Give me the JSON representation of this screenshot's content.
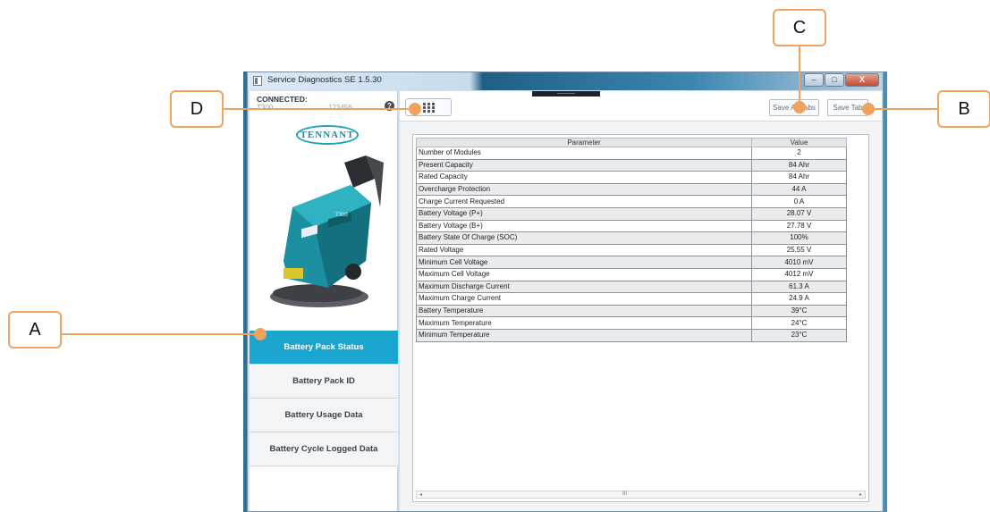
{
  "window": {
    "title": "Service Diagnostics SE 1.5.30",
    "minimize": "–",
    "maximize": "□",
    "close": "X"
  },
  "connection": {
    "status_label": "CONNECTED:",
    "model": "T300",
    "serial": "123456",
    "help": "?"
  },
  "brand": {
    "logo_text": "TENNANT",
    "accent_color": "#1aa6cf"
  },
  "sidebar": {
    "items": [
      {
        "label": "Battery Pack Status",
        "active": true
      },
      {
        "label": "Battery Pack ID",
        "active": false
      },
      {
        "label": "Battery Usage Data",
        "active": false
      },
      {
        "label": "Battery Cycle Logged Data",
        "active": false
      }
    ]
  },
  "toolbar": {
    "grid_icon": "grid-icon",
    "save_all_tabs": "Save All Tabs",
    "save_tab": "Save Tab"
  },
  "table": {
    "headers": [
      "Parameter",
      "Value"
    ],
    "rows": [
      [
        "Number of Modules",
        "2"
      ],
      [
        "Present Capacity",
        "84 Ahr"
      ],
      [
        "Rated Capacity",
        "84 Ahr"
      ],
      [
        "Overcharge Protection",
        "44 A"
      ],
      [
        "Charge Current Requested",
        "0 A"
      ],
      [
        "Battery Voltage (P+)",
        "28.07 V"
      ],
      [
        "Battery Voltage (B+)",
        "27.78 V"
      ],
      [
        "Battery State Of Charge (SOC)",
        "100%"
      ],
      [
        "Rated Voltage",
        "25.55 V"
      ],
      [
        "Minimum Cell Voltage",
        "4010 mV"
      ],
      [
        "Maximum Cell Voltage",
        "4012 mV"
      ],
      [
        "Maximum Discharge Current",
        "61.3 A"
      ],
      [
        "Maximum Charge Current",
        "24.9 A"
      ],
      [
        "Battery Temperature",
        "39°C"
      ],
      [
        "Maximum Temperature",
        "24°C"
      ],
      [
        "Minimum Temperature",
        "23°C"
      ]
    ],
    "scroll_left": "◂",
    "scroll_mid": "III",
    "scroll_right": "▸"
  },
  "callouts": {
    "a": "A",
    "b": "B",
    "c": "C",
    "d": "D"
  },
  "machine": {
    "badge": "T300"
  }
}
